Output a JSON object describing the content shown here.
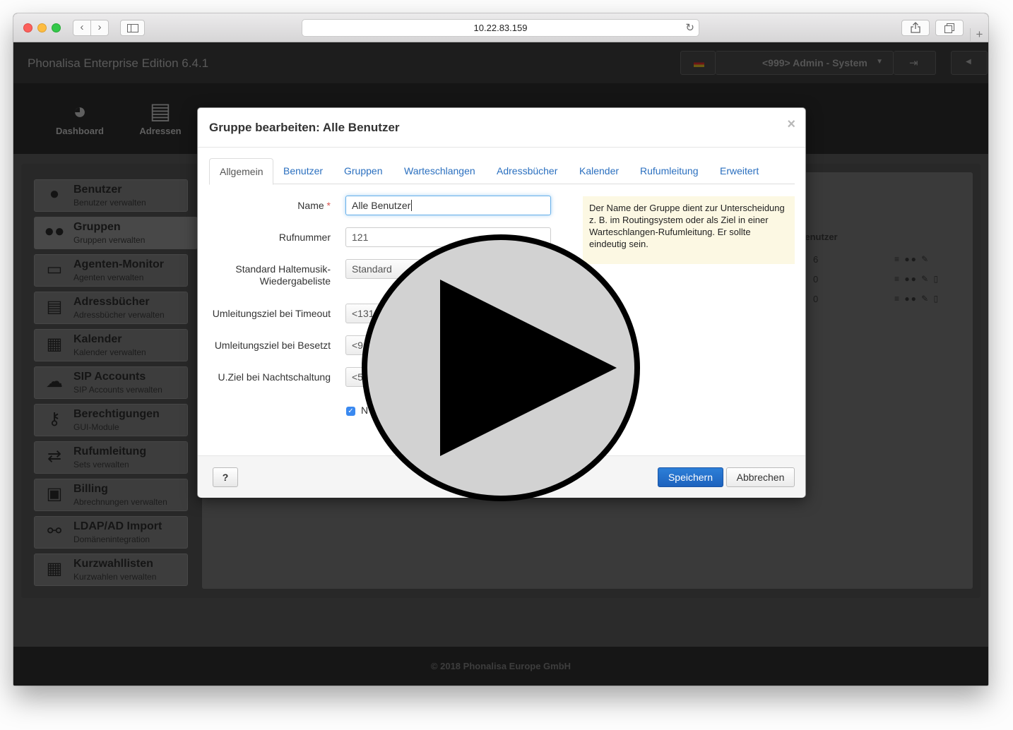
{
  "browser": {
    "url": "10.22.83.159",
    "icons": {
      "back": "chevron-left-icon",
      "forward": "chevron-right-icon",
      "sidebar": "sidebar-icon",
      "reload": "reload-icon",
      "share": "share-icon",
      "tabs": "tabs-icon",
      "new_tab": "plus-icon"
    }
  },
  "app": {
    "brand": "Phonalisa Enterprise Edition 6.4.1",
    "user": "<999> Admin - System",
    "top_nav": [
      {
        "label": "Dashboard",
        "icon": "dashboard-icon"
      },
      {
        "label": "Adressen",
        "icon": "book-icon"
      }
    ],
    "sidebar": [
      {
        "title": "Benutzer",
        "subtitle": "Benutzer verwalten",
        "icon": "user-icon"
      },
      {
        "title": "Gruppen",
        "subtitle": "Gruppen verwalten",
        "icon": "group-icon"
      },
      {
        "title": "Agenten-Monitor",
        "subtitle": "Agenten verwalten",
        "icon": "monitor-icon"
      },
      {
        "title": "Adressbücher",
        "subtitle": "Adressbücher verwalten",
        "icon": "book-icon"
      },
      {
        "title": "Kalender",
        "subtitle": "Kalender verwalten",
        "icon": "calendar-icon"
      },
      {
        "title": "SIP Accounts",
        "subtitle": "SIP Accounts verwalten",
        "icon": "cloud-icon"
      },
      {
        "title": "Berechtigungen",
        "subtitle": "GUI-Module",
        "icon": "key-icon"
      },
      {
        "title": "Rufumleitung",
        "subtitle": "Sets verwalten",
        "icon": "retweet-icon"
      },
      {
        "title": "Billing",
        "subtitle": "Abrechnungen verwalten",
        "icon": "money-icon"
      },
      {
        "title": "LDAP/AD Import",
        "subtitle": "Domänenintegration",
        "icon": "link-icon"
      },
      {
        "title": "Kurzwahllisten",
        "subtitle": "Kurzwahlen verwalten",
        "icon": "grid-icon"
      }
    ],
    "table": {
      "header": "Benutzer",
      "rows": [
        "6",
        "0",
        "0"
      ]
    },
    "footer": "© 2018 Phonalisa Europe GmbH"
  },
  "modal": {
    "title": "Gruppe bearbeiten: Alle Benutzer",
    "close": "×",
    "tabs": [
      "Allgemein",
      "Benutzer",
      "Gruppen",
      "Warteschlangen",
      "Adressbücher",
      "Kalender",
      "Rufumleitung",
      "Erweitert"
    ],
    "fields": {
      "name_label": "Name",
      "name_required": "*",
      "name_value": "Alle Benutzer",
      "number_label": "Rufnummer",
      "number_value": "121",
      "moh_label_1": "Standard Haltemusik-",
      "moh_label_2": "Wiedergabeliste",
      "moh_value": "Standard",
      "timeout_label": "Umleitungsziel bei Timeout",
      "timeout_value": "<131",
      "busy_label": "Umleitungsziel bei Besetzt",
      "busy_value": "<9",
      "night_label": "U.Ziel bei Nachtschaltung",
      "night_value": "<5",
      "checkbox_label": "N",
      "checkbox_checked": true
    },
    "help_text": "Der Name der Gruppe dient zur Unterscheidung z. B. im Routingsystem oder als Ziel in einer Warteschlangen-Rufumleitung. Er sollte eindeutig sein.",
    "help_button": "?",
    "save": "Speichern",
    "cancel": "Abbrechen"
  },
  "overlay": {
    "icon": "play-icon"
  }
}
